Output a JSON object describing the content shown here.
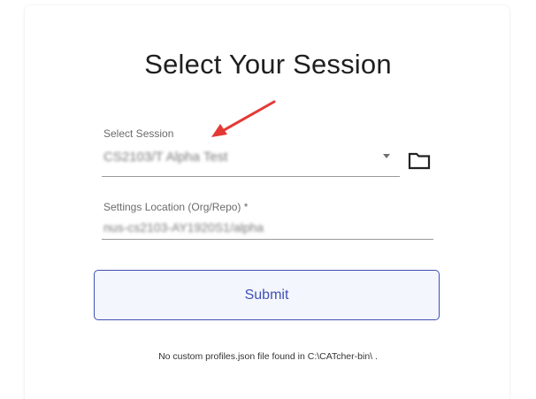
{
  "heading": "Select Your Session",
  "session": {
    "label": "Select Session",
    "value": "CS2103/T Alpha Test"
  },
  "settings": {
    "label": "Settings Location (Org/Repo) *",
    "value": "nus-cs2103-AY1920S1/alpha"
  },
  "submit_label": "Submit",
  "footnote": "No custom profiles.json file found in C:\\CATcher-bin\\ .",
  "colors": {
    "accent": "#3f51b5",
    "annotation_arrow": "#e53935"
  },
  "icons": {
    "dropdown": "chevron-down-icon",
    "folder": "folder-icon",
    "annotation": "arrow-annotation-icon"
  }
}
